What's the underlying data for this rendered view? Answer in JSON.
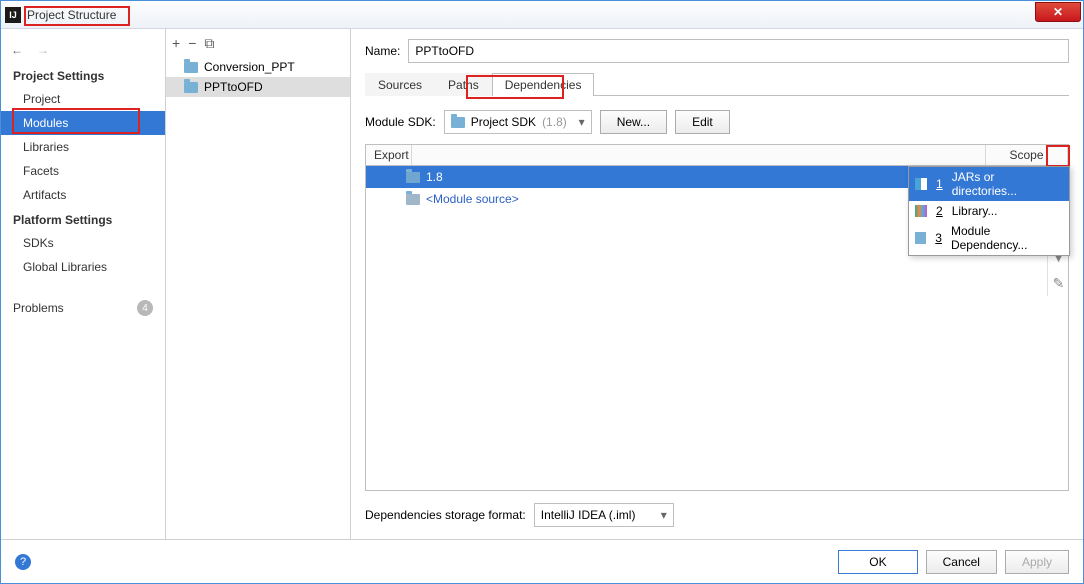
{
  "window_title": "Project Structure",
  "sidebar": {
    "section1": "Project Settings",
    "items1": [
      "Project",
      "Modules",
      "Libraries",
      "Facets",
      "Artifacts"
    ],
    "section2": "Platform Settings",
    "items2": [
      "SDKs",
      "Global Libraries"
    ],
    "problems": "Problems",
    "badge": "4"
  },
  "tree": {
    "items": [
      "Conversion_PPT",
      "PPTtoOFD"
    ]
  },
  "main": {
    "name_label": "Name:",
    "name_value": "PPTtoOFD",
    "tabs": [
      "Sources",
      "Paths",
      "Dependencies"
    ],
    "sdk_label": "Module SDK:",
    "sdk_value": "Project SDK",
    "sdk_ver": "(1.8)",
    "new_btn": "New...",
    "edit_btn": "Edit",
    "th_export": "Export",
    "th_scope": "Scope",
    "rows": [
      {
        "label": "1.8"
      },
      {
        "label": "<Module source>"
      }
    ],
    "storage_label": "Dependencies storage format:",
    "storage_value": "IntelliJ IDEA (.iml)"
  },
  "popup": {
    "items": [
      {
        "n": "1",
        "label": "JARs or directories..."
      },
      {
        "n": "2",
        "label": "Library..."
      },
      {
        "n": "3",
        "label": "Module Dependency..."
      }
    ]
  },
  "footer": {
    "ok": "OK",
    "cancel": "Cancel",
    "apply": "Apply"
  }
}
